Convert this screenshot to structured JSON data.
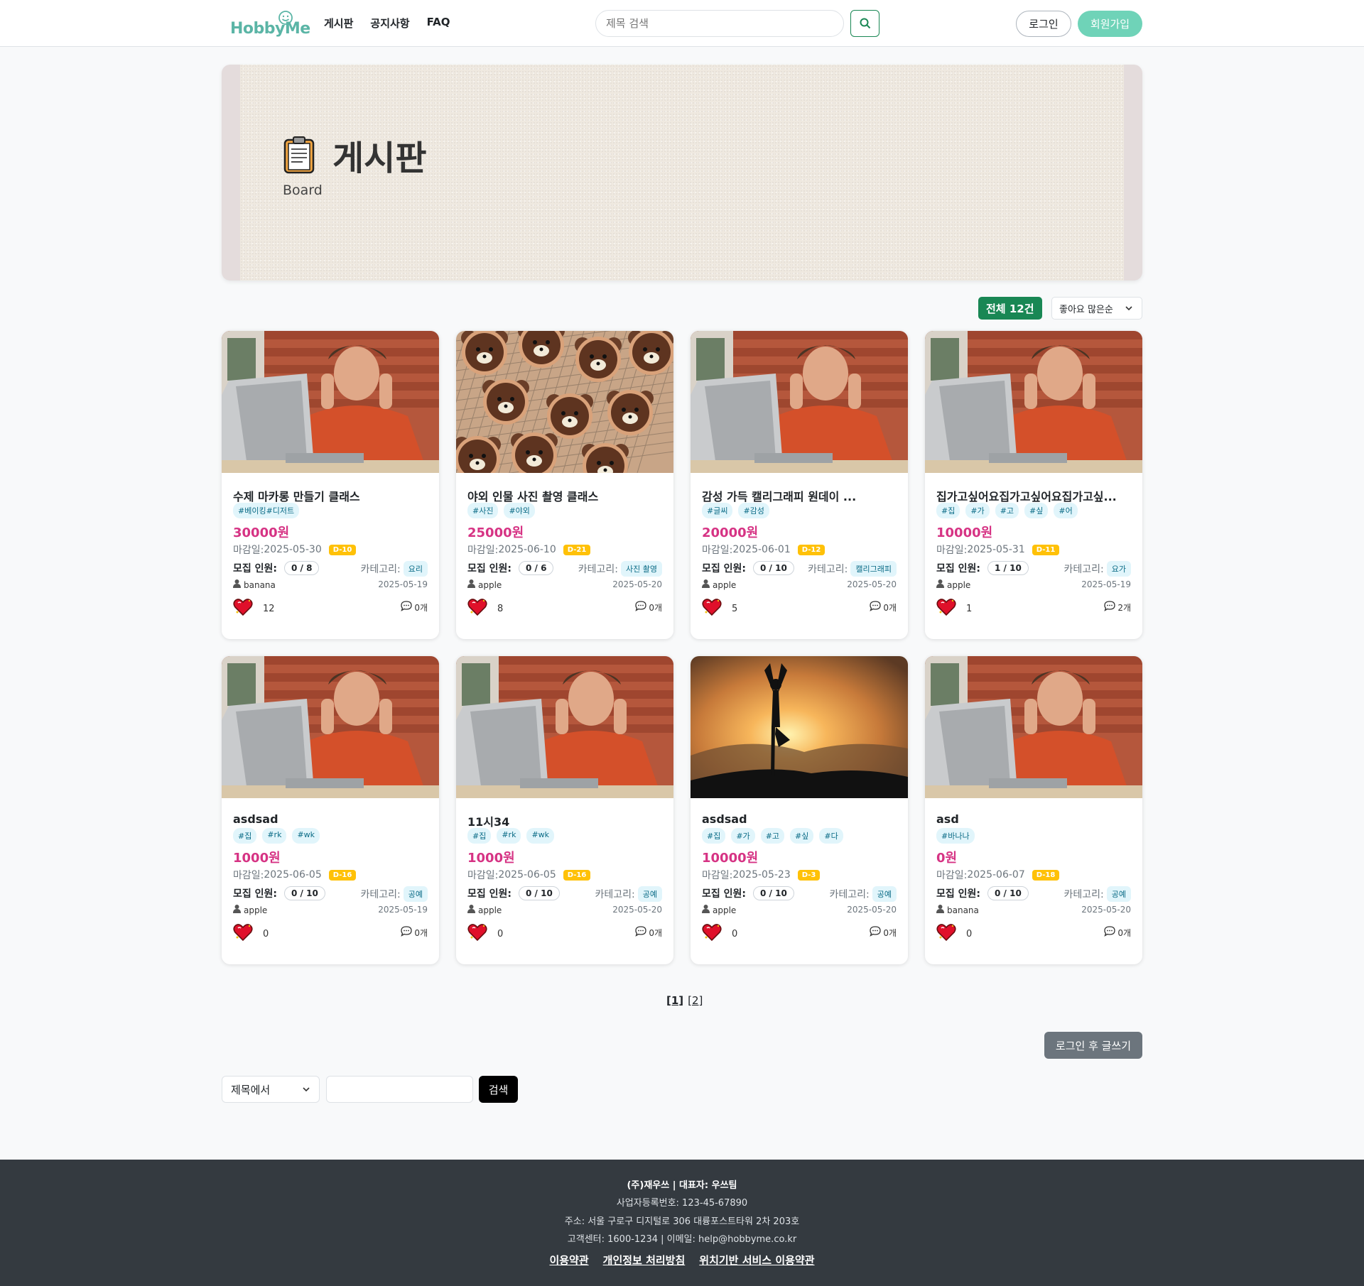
{
  "header": {
    "logo_text": "HobbyMe",
    "nav": [
      "게시판",
      "공지사항",
      "FAQ"
    ],
    "search_placeholder": "제목 검색",
    "login_label": "로그인",
    "signup_label": "회원가입",
    "brand_color": "#6fd3b8",
    "accent_color": "#198754"
  },
  "banner": {
    "title": "게시판",
    "subtitle": "Board",
    "icon": "clipboard-icon"
  },
  "toolbar": {
    "total_label": "전체 12건",
    "sort_selected": "좋아요 많은순"
  },
  "labels": {
    "deadline_prefix": "마감일: ",
    "recruit_label": "모집 인원:",
    "category_label": "카테고리:"
  },
  "cards": [
    {
      "title": "수제 마카롱 만들기 클래스",
      "tags": [
        "#베이킹#디저트"
      ],
      "price": "30000원",
      "deadline": "2025-05-30",
      "dday": "D-10",
      "recruit": "0 / 8",
      "category": "요리",
      "author": "banana",
      "date": "2025-05-19",
      "likes": "12",
      "comments": "0개",
      "image": "man-at-laptop"
    },
    {
      "title": "야외 인물 사진 촬영 클래스",
      "tags": [
        "#사진",
        "#야외"
      ],
      "price": "25000원",
      "deadline": "2025-06-10",
      "dday": "D-21",
      "recruit": "0 / 6",
      "category": "사진 촬영",
      "author": "apple",
      "date": "2025-05-20",
      "likes": "8",
      "comments": "0개",
      "image": "bear-cookies"
    },
    {
      "title": "감성 가득 캘리그래피 원데이 ...",
      "tags": [
        "#글씨",
        "#감성"
      ],
      "price": "20000원",
      "deadline": "2025-06-01",
      "dday": "D-12",
      "recruit": "0 / 10",
      "category": "캘리그래피",
      "author": "apple",
      "date": "2025-05-20",
      "likes": "5",
      "comments": "0개",
      "image": "man-at-laptop"
    },
    {
      "title": "집가고싶어요집가고싶어요집가고싶...",
      "tags": [
        "#집",
        "#가",
        "#고",
        "#싶",
        "#어"
      ],
      "price": "10000원",
      "deadline": "2025-05-31",
      "dday": "D-11",
      "recruit": "1 / 10",
      "category": "요가",
      "author": "apple",
      "date": "2025-05-19",
      "likes": "1",
      "comments": "2개",
      "image": "man-at-laptop"
    },
    {
      "title": "asdsad",
      "tags": [
        "#집",
        "#rk",
        "#wk"
      ],
      "price": "1000원",
      "deadline": "2025-06-05",
      "dday": "D-16",
      "recruit": "0 / 10",
      "category": "공예",
      "author": "apple",
      "date": "2025-05-19",
      "likes": "0",
      "comments": "0개",
      "image": "man-at-laptop"
    },
    {
      "title": "11시34",
      "tags": [
        "#집",
        "#rk",
        "#wk"
      ],
      "price": "1000원",
      "deadline": "2025-06-05",
      "dday": "D-16",
      "recruit": "0 / 10",
      "category": "공예",
      "author": "apple",
      "date": "2025-05-20",
      "likes": "0",
      "comments": "0개",
      "image": "man-at-laptop"
    },
    {
      "title": "asdsad",
      "tags": [
        "#집",
        "#가",
        "#고",
        "#싶",
        "#다"
      ],
      "price": "10000원",
      "deadline": "2025-05-23",
      "dday": "D-3",
      "recruit": "0 / 10",
      "category": "공예",
      "author": "apple",
      "date": "2025-05-20",
      "likes": "0",
      "comments": "0개",
      "image": "yoga-silhouette"
    },
    {
      "title": "asd",
      "tags": [
        "#바나나"
      ],
      "price": "0원",
      "deadline": "2025-06-07",
      "dday": "D-18",
      "recruit": "0 / 10",
      "category": "공예",
      "author": "banana",
      "date": "2025-05-20",
      "likes": "0",
      "comments": "0개",
      "image": "man-at-laptop"
    }
  ],
  "pagination": {
    "current": "[1]",
    "pages": [
      "[2]"
    ]
  },
  "write_button": "로그인 후 글쓰기",
  "bottom_search": {
    "type_selected": "제목에서",
    "submit_label": "검색"
  },
  "footer": {
    "company": "(주)재우쓰 | 대표자: 우쓰팀",
    "biz_no": "사업자등록번호: 123-45-67890",
    "address": "주소: 서울 구로구 디지털로 306 대륭포스트타워 2차 203호",
    "contact": "고객센터: 1600-1234 | 이메일: help@hobbyme.co.kr",
    "links": [
      "이용약관",
      "개인정보 처리방침",
      "위치기반 서비스 이용약관"
    ]
  }
}
